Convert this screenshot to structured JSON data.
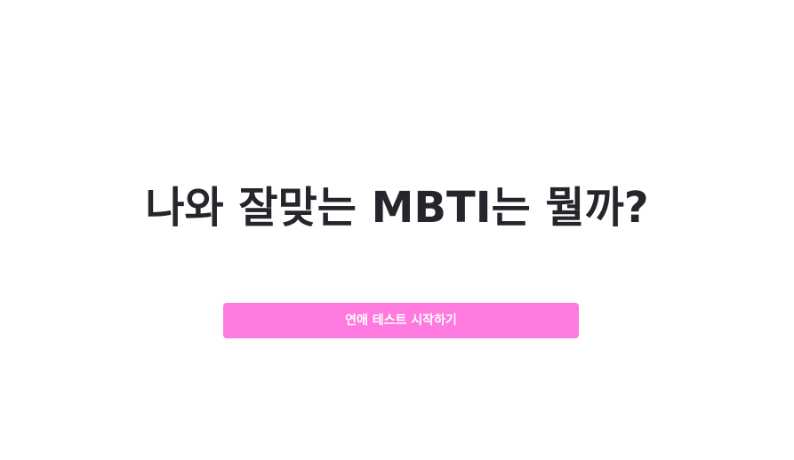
{
  "main": {
    "title": "나와 잘맞는 MBTI는 뭘까?",
    "start_button_label": "연애 테스트 시작하기"
  },
  "colors": {
    "button_background": "#ff7ade",
    "button_text": "#ffffff",
    "title_text": "#25262b",
    "page_background": "#ffffff"
  }
}
